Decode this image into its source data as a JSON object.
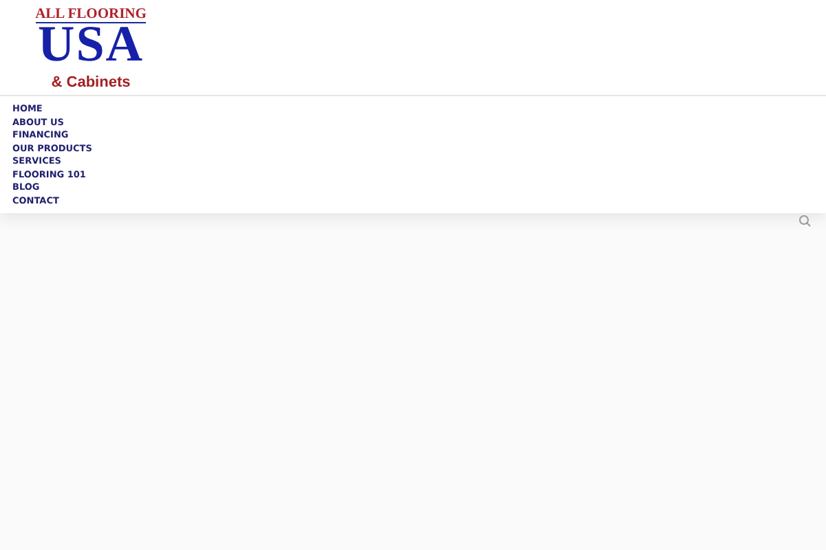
{
  "logo": {
    "top": "ALL FLOORING",
    "main": "USA",
    "sub": "& Cabinets"
  },
  "nav": [
    {
      "label": "HOME"
    },
    {
      "label": "ABOUT US"
    },
    {
      "label": "FINANCING"
    },
    {
      "label": "OUR PRODUCTS"
    },
    {
      "label": "SERVICES"
    },
    {
      "label": "FLOORING 101"
    },
    {
      "label": "BLOG"
    },
    {
      "label": "CONTACT"
    }
  ]
}
